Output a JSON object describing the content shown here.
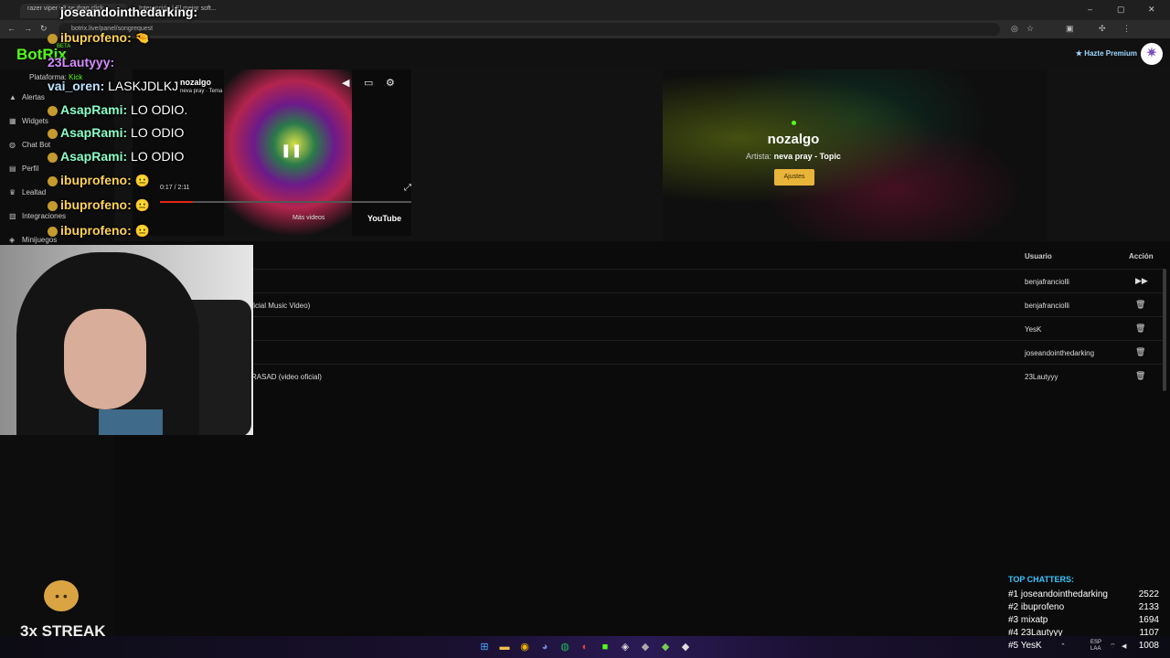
{
  "browser": {
    "tabs": [
      {
        "label": "razer viper v3 se drag click - ..."
      },
      {
        "label": "Interacción | El mejor soft..."
      }
    ],
    "url": "botrix.live/panel/songrequest",
    "window_controls": {
      "minimize": "–",
      "maximize": "▢",
      "close": "✕"
    }
  },
  "app": {
    "brand": "BotRix",
    "beta": "BETA",
    "premium_label": "Hazte Premium",
    "platform_label": "Plataforma:",
    "platform_value": "Kick"
  },
  "sidebar": {
    "items": [
      {
        "label": "Alertas",
        "icon": "bell-icon"
      },
      {
        "label": "Widgets",
        "icon": "widgets-icon"
      },
      {
        "label": "Chat Bot",
        "icon": "robot-icon"
      },
      {
        "label": "Perfil",
        "icon": "profile-icon"
      },
      {
        "label": "Lealtad",
        "icon": "trophy-icon"
      },
      {
        "label": "Integraciones",
        "icon": "integrations-icon"
      },
      {
        "label": "Minijuegos",
        "icon": "gamepad-icon"
      }
    ]
  },
  "player": {
    "video_title": "nozalgo",
    "video_subtitle": "neva pray · Tema",
    "time": "0:17 / 2:11",
    "progress": 0.13,
    "more_videos": "Más videos",
    "youtube": "YouTube",
    "now_playing_title": "nozalgo",
    "artist_label": "Artista:",
    "artist_value": "neva pray - Topic",
    "settings_button": "Ajustes"
  },
  "queue": {
    "headers": {
      "user": "Usuario",
      "action": "Acción"
    },
    "rows": [
      {
        "song": "",
        "user": "benjafranciolli",
        "action": "play"
      },
      {
        "song": "ficial Music Video)",
        "user": "benjafranciolli",
        "action": "delete"
      },
      {
        "song": "",
        "user": "YesK",
        "action": "delete"
      },
      {
        "song": "",
        "user": "joseandointhedarking",
        "action": "delete"
      },
      {
        "song": "RASAD (video oficial)",
        "user": "23Lautyyy",
        "action": "delete"
      }
    ]
  },
  "chat": {
    "messages": [
      {
        "user": "joseandointhedarking:",
        "text": "",
        "color": "#ffffff"
      },
      {
        "user": "ibuprofeno:",
        "text": "",
        "color": "#ffd257"
      },
      {
        "user": "23Lautyyy:",
        "text": "",
        "color": "#d58cff"
      },
      {
        "user": "vai_oren:",
        "text": "LASKJDLKJ",
        "color": "#bfe3ff"
      },
      {
        "user": "AsapRami:",
        "text": "LO ODIO.",
        "color": "#8bffc8"
      },
      {
        "user": "AsapRami:",
        "text": "LO ODIO",
        "color": "#8bffc8"
      },
      {
        "user": "AsapRami:",
        "text": "LO ODIO",
        "color": "#8bffc8"
      },
      {
        "user": "ibuprofeno:",
        "text": "",
        "color": "#ffd257"
      },
      {
        "user": "ibuprofeno:",
        "text": "",
        "color": "#ffd257"
      },
      {
        "user": "ibuprofeno:",
        "text": "",
        "color": "#ffd257"
      }
    ]
  },
  "streak": {
    "label": "3x STREAK"
  },
  "top_chatters": {
    "title": "TOP CHATTERS:",
    "rows": [
      {
        "rank": "#1",
        "name": "joseandointhedarking",
        "count": "2522"
      },
      {
        "rank": "#2",
        "name": "ibuprofeno",
        "count": "2133"
      },
      {
        "rank": "#3",
        "name": "mixatp",
        "count": "1694"
      },
      {
        "rank": "#4",
        "name": "23Lautyyy",
        "count": "1107"
      },
      {
        "rank": "#5",
        "name": "YesK",
        "count": "1008"
      }
    ]
  },
  "taskbar": {
    "lang": "ESP",
    "lang_sub": "LAA"
  }
}
